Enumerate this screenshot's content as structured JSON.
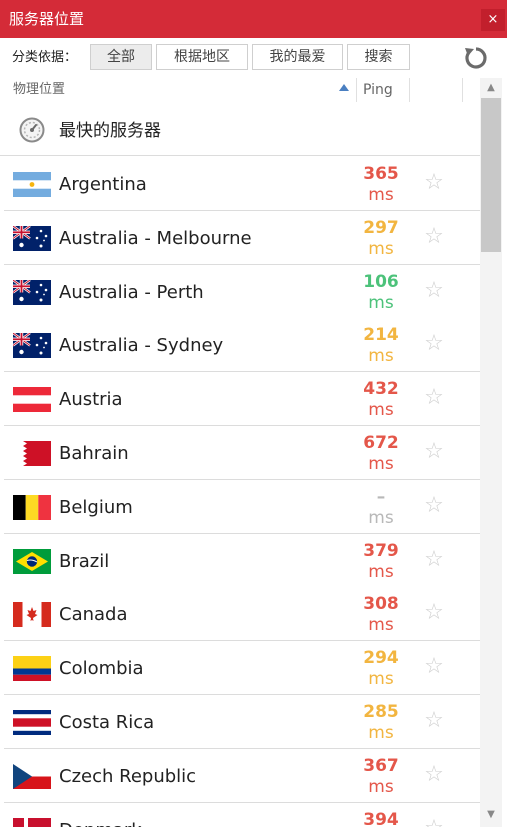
{
  "window": {
    "title": "服务器位置",
    "close_label": "×"
  },
  "filter": {
    "label": "分类依据：",
    "buttons": [
      "全部",
      "根据地区",
      "我的最爱",
      "搜索"
    ],
    "active_index": 0,
    "refresh_icon": "refresh-icon"
  },
  "columns": {
    "location": "物理位置",
    "ping": "Ping"
  },
  "fastest": {
    "label": "最快的服务器",
    "icon": "gauge-icon"
  },
  "colors": {
    "titlebar": "#d42b38",
    "ping_high": "#e4574a",
    "ping_mid": "#f2b540",
    "ping_low": "#4cc27a",
    "ping_none": "#b8b8b8"
  },
  "servers": [
    {
      "name": "Argentina",
      "ping": "365",
      "unit": "ms",
      "level": "red",
      "flag": "argentina"
    },
    {
      "name": "Australia - Melbourne",
      "ping": "297",
      "unit": "ms",
      "level": "orange",
      "flag": "australia"
    },
    {
      "name": "Australia - Perth",
      "ping": "106",
      "unit": "ms",
      "level": "green",
      "flag": "australia"
    },
    {
      "name": "Australia - Sydney",
      "ping": "214",
      "unit": "ms",
      "level": "orange",
      "flag": "australia"
    },
    {
      "name": "Austria",
      "ping": "432",
      "unit": "ms",
      "level": "red",
      "flag": "austria"
    },
    {
      "name": "Bahrain",
      "ping": "672",
      "unit": "ms",
      "level": "red",
      "flag": "bahrain"
    },
    {
      "name": "Belgium",
      "ping": "–",
      "unit": "ms",
      "level": "gray",
      "flag": "belgium"
    },
    {
      "name": "Brazil",
      "ping": "379",
      "unit": "ms",
      "level": "red",
      "flag": "brazil"
    },
    {
      "name": "Canada",
      "ping": "308",
      "unit": "ms",
      "level": "red",
      "flag": "canada"
    },
    {
      "name": "Colombia",
      "ping": "294",
      "unit": "ms",
      "level": "orange",
      "flag": "colombia"
    },
    {
      "name": "Costa Rica",
      "ping": "285",
      "unit": "ms",
      "level": "orange",
      "flag": "costa-rica"
    },
    {
      "name": "Czech Republic",
      "ping": "367",
      "unit": "ms",
      "level": "red",
      "flag": "czech"
    },
    {
      "name": "Denmark",
      "ping": "394",
      "unit": "ms",
      "level": "red",
      "flag": "denmark"
    }
  ]
}
